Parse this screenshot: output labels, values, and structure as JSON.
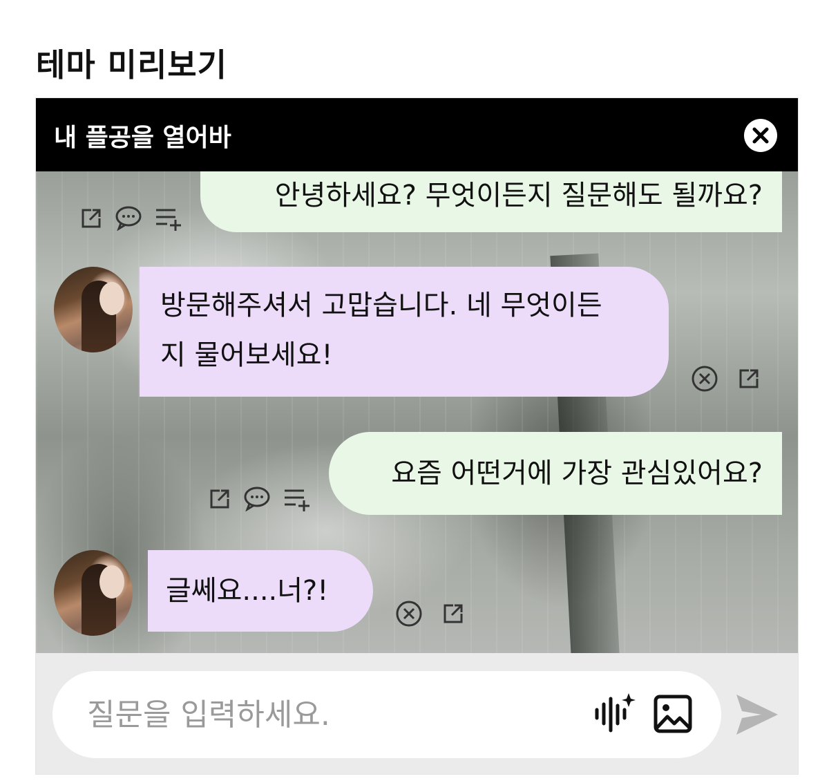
{
  "page": {
    "title": "테마 미리보기"
  },
  "header": {
    "title": "내 플공을 열어바"
  },
  "messages": [
    {
      "role": "user",
      "text": "안녕하세요? 무엇이든지 질문해도 될까요?"
    },
    {
      "role": "bot",
      "line1": "방문해주셔서 고맙습니다. 네 무엇이든",
      "line2": "지 물어보세요!"
    },
    {
      "role": "user",
      "text": "요즘 어떤거에 가장 관심있어요?"
    },
    {
      "role": "bot",
      "text": "글쎄요....너?!"
    }
  ],
  "input": {
    "placeholder": "질문을 입력하세요."
  },
  "icons": {
    "close": "close-icon",
    "share": "share-icon",
    "comment": "comment-icon",
    "playlist_add": "playlist-add-icon",
    "dismiss": "dismiss-circle-icon",
    "voice": "voice-sparkle-icon",
    "image": "image-icon",
    "send": "send-icon"
  },
  "colors": {
    "header_bg": "#000000",
    "user_bubble": "#e9f8e6",
    "bot_bubble": "#ecdcfa",
    "input_bar_bg": "#ebebeb",
    "send_disabled": "#b5b5b5"
  }
}
